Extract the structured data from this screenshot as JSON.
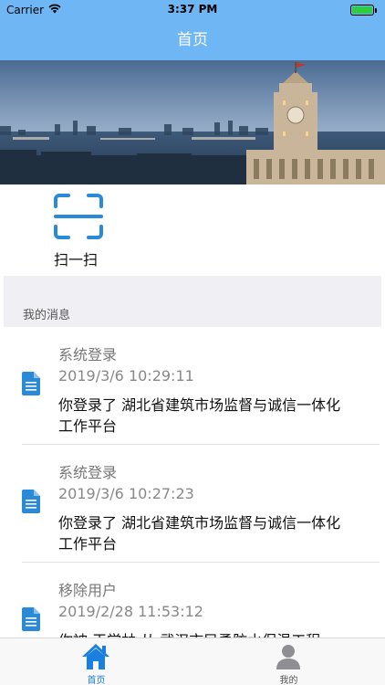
{
  "status_bar": {
    "carrier": "Carrier",
    "time": "3:37 PM",
    "battery_level_percent": 100
  },
  "navbar": {
    "title": "首页"
  },
  "banner": {
    "image": "city-skyline-clock-tower"
  },
  "scan": {
    "label": "扫一扫",
    "icon": "scan-icon"
  },
  "messages": {
    "section_title": "我的消息",
    "items": [
      {
        "title": "系统登录",
        "time": "2019/3/6 10:29:11",
        "content": "你登录了 湖北省建筑市场监督与诚信一体化工作平台",
        "icon": "document-icon"
      },
      {
        "title": "系统登录",
        "time": "2019/3/6 10:27:23",
        "content": "你登录了 湖北省建筑市场监督与诚信一体化工作平台",
        "icon": "document-icon"
      },
      {
        "title": "移除用户",
        "time": "2019/2/28 11:53:12",
        "content": "你被 王学林 从 武汉市民勇防水保温工程",
        "icon": "document-icon"
      }
    ]
  },
  "tabbar": {
    "home_label": "首页",
    "mine_label": "我的",
    "active_color": "#1a7fe0",
    "inactive_color": "#8e8e93"
  },
  "colors": {
    "nav_background": "#6fb6f5",
    "section_background": "#efeff4",
    "icon_blue": "#2a8ad8"
  }
}
